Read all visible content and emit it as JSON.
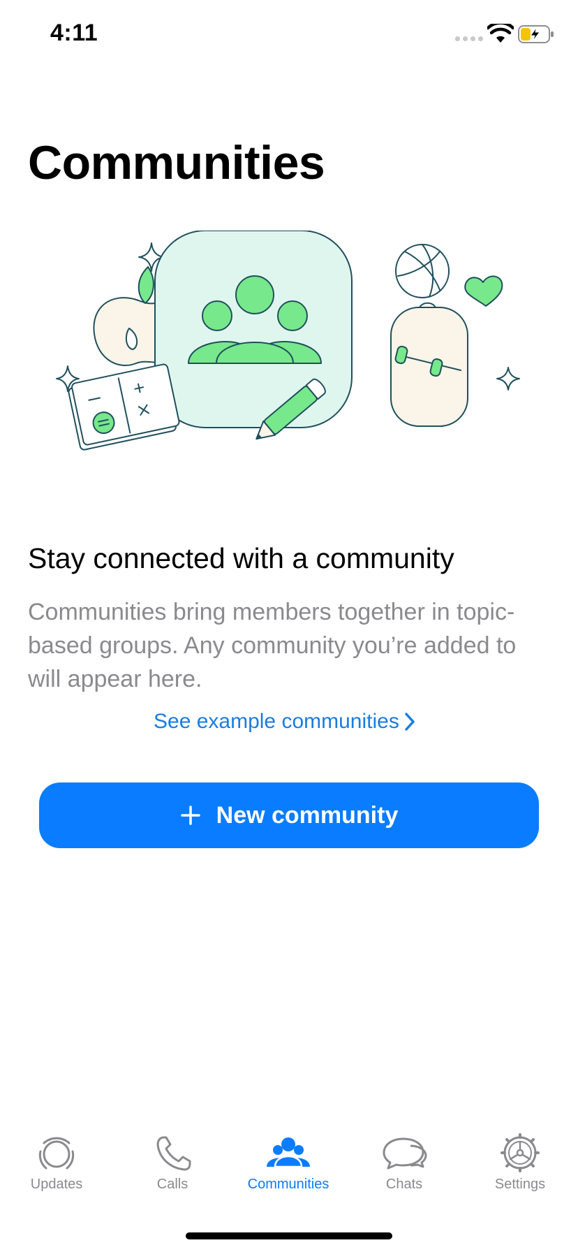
{
  "status_bar": {
    "time": "4:11"
  },
  "page": {
    "title": "Communities",
    "headline": "Stay connected with a community",
    "description": "Communities bring members together in topic-based groups. Any community you’re added to will appear here.",
    "example_link": "See example communities",
    "new_community_button": "New community"
  },
  "tab_bar": {
    "tabs": [
      {
        "label": "Updates",
        "icon": "updates-icon",
        "active": false
      },
      {
        "label": "Calls",
        "icon": "phone-icon",
        "active": false
      },
      {
        "label": "Communities",
        "icon": "communities-icon",
        "active": true
      },
      {
        "label": "Chats",
        "icon": "chats-icon",
        "active": false
      },
      {
        "label": "Settings",
        "icon": "gear-icon",
        "active": false
      }
    ]
  },
  "colors": {
    "accent": "#0a7cff",
    "link": "#1a7de0",
    "illustration_green": "#77e88b",
    "illustration_tile": "#dff6ef",
    "illustration_outline": "#1f4f5c",
    "secondary_text": "#8a8a8e"
  }
}
